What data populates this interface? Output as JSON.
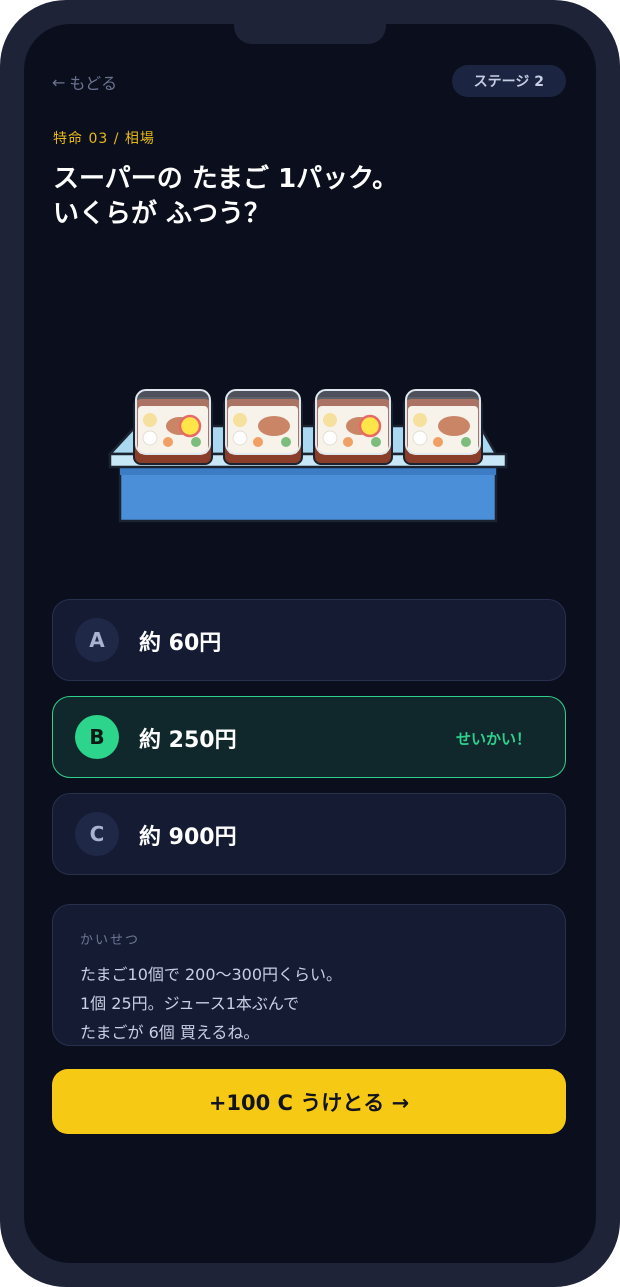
{
  "nav": {
    "back_arrow": "←",
    "back_label": "もどる",
    "stage_badge": "ステージ 2"
  },
  "header": {
    "mission_label": "特命 03 / 相場",
    "question_line1": "スーパーの たまご 1パック。",
    "question_line2": "いくらが ふつう？"
  },
  "illustration": {
    "icon": "bento-shelf-illustration"
  },
  "options": [
    {
      "key": "A",
      "label": "約 60円",
      "state": "default"
    },
    {
      "key": "B",
      "label": "約 250円",
      "state": "correct",
      "tag": "せいかい！"
    },
    {
      "key": "C",
      "label": "約 900円",
      "state": "default"
    }
  ],
  "explanation": {
    "title": "かいせつ",
    "lines": [
      "たまご10個で 200〜300円くらい。",
      "1個 25円。ジュース1本ぶんで",
      "たまごが 6個 買えるね。"
    ]
  },
  "cta": {
    "label": "+100 C うけとる →"
  },
  "colors": {
    "background": "#0b0f1d",
    "accent_yellow": "#f6c915",
    "correct_green": "#2fd08c",
    "card": "#141b33"
  }
}
